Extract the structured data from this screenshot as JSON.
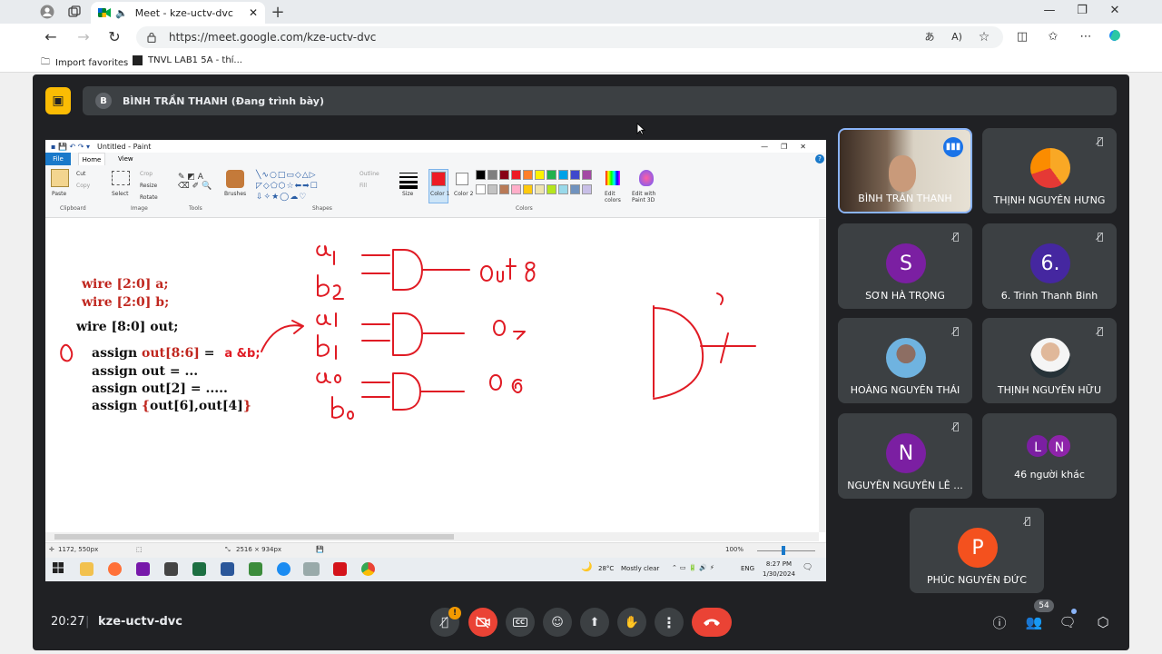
{
  "browser": {
    "tab_title": "Meet - kze-uctv-dvc",
    "url": "https://meet.google.com/kze-uctv-dvc",
    "favorites": [
      "Import favorites",
      "TNVL LAB1 5A - thí..."
    ]
  },
  "presenter_bar": {
    "avatar_letter": "B",
    "text": "BÌNH TRẦN THANH (Đang trình bày)"
  },
  "paint": {
    "title": "Untitled - Paint",
    "menu": [
      "File",
      "Home",
      "View"
    ],
    "clipboard": {
      "paste": "Paste",
      "cut": "Cut",
      "copy": "Copy",
      "group": "Clipboard"
    },
    "image": {
      "select": "Select",
      "crop": "Crop",
      "resize": "Resize",
      "rotate": "Rotate",
      "group": "Image"
    },
    "tools_group": "Tools",
    "brushes": "Brushes",
    "shapes": {
      "outline": "Outline",
      "fill": "Fill",
      "group": "Shapes"
    },
    "size": "Size",
    "color1": "Color 1",
    "color2": "Color 2",
    "colors_group": "Colors",
    "edit_colors": "Edit colors",
    "edit_with_paint3d": "Edit with Paint 3D",
    "palette": [
      "#000000",
      "#7f7f7f",
      "#880015",
      "#ed1c24",
      "#ff7f27",
      "#fff200",
      "#22b14c",
      "#00a2e8",
      "#3f48cc",
      "#a349a4",
      "#ffffff",
      "#c3c3c3",
      "#b97a57",
      "#ffaec9",
      "#ffc90e",
      "#efe4b0",
      "#b5e61d",
      "#99d9ea",
      "#7092be",
      "#c8bfe7"
    ],
    "status": {
      "cursor": "1172, 550px",
      "size": "2516 × 934px",
      "zoom": "100%"
    }
  },
  "code": {
    "line1": "wire [2:0] a;",
    "line2": "wire [2:0] b;",
    "line3": "wire [8:0] out;",
    "line4_kw": "assign ",
    "line4_red": "out[8:6]",
    "line4_eq": " =",
    "line4_hand": "a &b;",
    "line5": "assign out = ...",
    "line6": "assign out[2] = .....",
    "line7_kw": "assign ",
    "line7_brace_open": "{",
    "line7_mid": "out[6],out[4]",
    "line7_brace_close": "}"
  },
  "taskbar": {
    "weather": "28°C",
    "weather_desc": "Mostly clear",
    "lang": "ENG",
    "time": "8:27 PM",
    "date": "1/30/2024"
  },
  "participants": [
    {
      "name": "BÌNH TRẦN THANH",
      "video": true
    },
    {
      "name": "THỊNH NGUYỄN HƯNG",
      "letter": ""
    },
    {
      "name": "SƠN HÀ TRỌNG",
      "letter": "S"
    },
    {
      "name": "6. Trinh Thanh Binh",
      "letter": "6."
    },
    {
      "name": "HOÀNG NGUYỄN THÁI",
      "letter": ""
    },
    {
      "name": "THỊNH NGUYỄN HỮU",
      "letter": ""
    },
    {
      "name": "NGUYỄN NGUYỄN LÊ ...",
      "letter": "N"
    },
    {
      "name": "46 người khác",
      "letters": [
        "L",
        "N"
      ]
    },
    {
      "name": "PHÚC NGUYỄN ĐỨC",
      "letter": "P"
    }
  ],
  "footer": {
    "time": "20:27",
    "code": "kze-uctv-dvc",
    "people_badge": "54",
    "mic_alert": "!"
  },
  "colors": {
    "accent_red": "#ea4335",
    "presenting_yellow": "#fbbc04",
    "meet_bg": "#202124",
    "tile_bg": "#3c4043",
    "purple_avatar": "#7b1fa2",
    "orange_avatar": "#f4511e"
  }
}
